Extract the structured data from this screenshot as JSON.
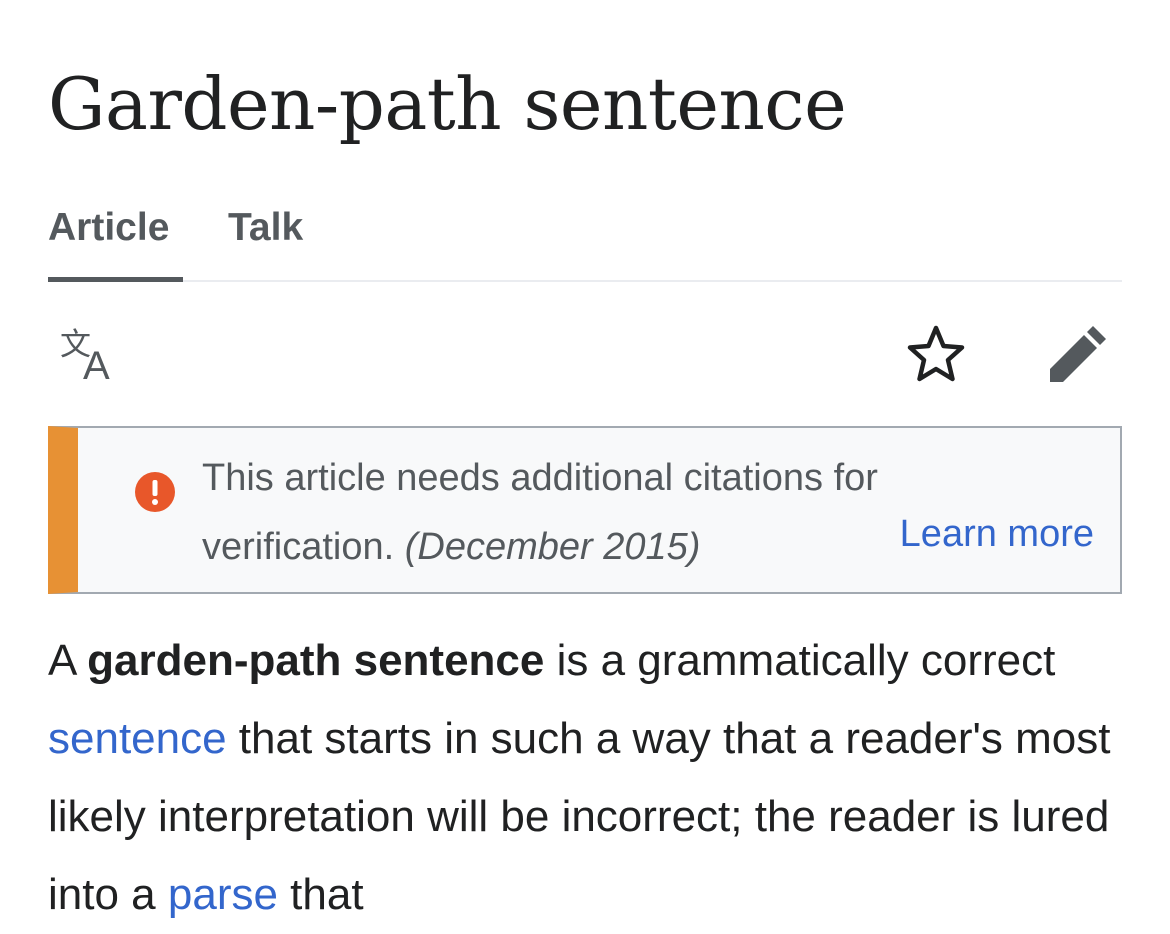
{
  "article": {
    "title": "Garden-path sentence"
  },
  "tabs": [
    {
      "label": "Article",
      "active": true
    },
    {
      "label": "Talk",
      "active": false
    }
  ],
  "toolbar": {
    "language_icon": "translate-icon",
    "watch_icon": "star-icon",
    "edit_icon": "pencil-icon"
  },
  "notice": {
    "icon": "exclamation-circle-icon",
    "text_line1": "This article needs additional citations for",
    "text_line2": "verification.",
    "date": "(December 2015)",
    "link_label": "Learn more"
  },
  "lead": {
    "p1": "A ",
    "bold_term": "garden-path sentence",
    "p2": " is a grammatically correct ",
    "link1": "sentence",
    "p3": " that starts in such a way that a reader's most likely interpretation will be incorrect; the reader is lured into a ",
    "link2": "parse",
    "p4": " that"
  },
  "colors": {
    "text": "#202122",
    "secondary_text": "#54595d",
    "link": "#3366cc",
    "notice_stripe": "#e79134",
    "notice_icon": "#e8572a",
    "notice_bg": "#f8f9fa",
    "notice_border": "#a2a9b1",
    "divider": "#eaecf0"
  }
}
